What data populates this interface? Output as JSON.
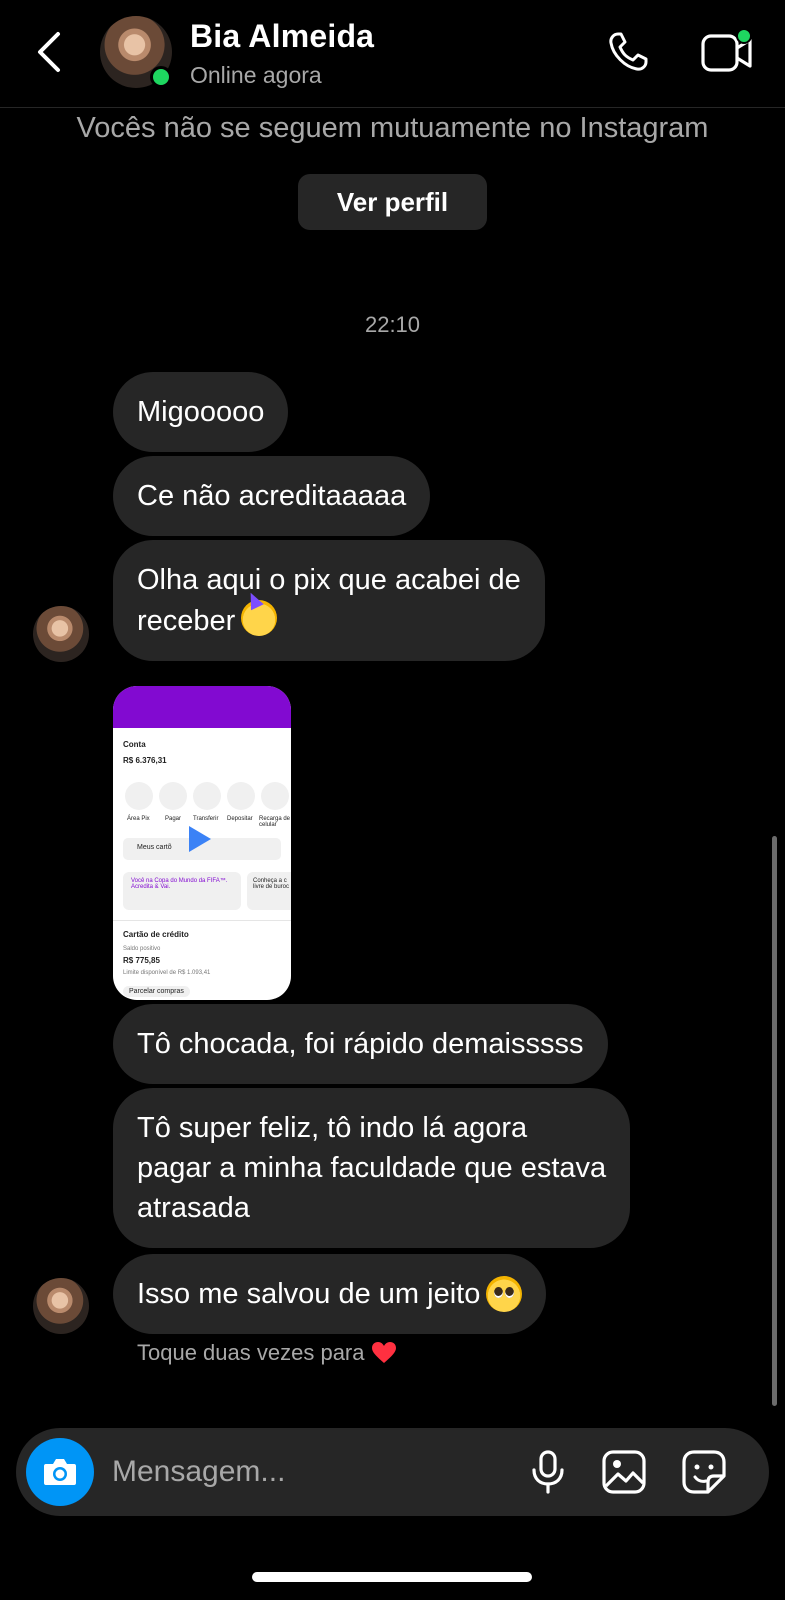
{
  "header": {
    "name": "Bia Almeida",
    "status": "Online agora",
    "back_icon": "chevron-left-icon",
    "call_icon": "phone-icon",
    "video_icon": "video-camera-icon"
  },
  "banner": {
    "mutual_text": "Vocês não se seguem mutuamente no Instagram",
    "view_profile": "Ver perfil"
  },
  "timestamp": "22:10",
  "messages": [
    {
      "text": "Migooooo"
    },
    {
      "text": "Ce não acreditaaaaa"
    },
    {
      "line1": "Olha aqui o pix que acabei de",
      "line2": "receber",
      "emoji": "partying-face"
    },
    {
      "text": "Tô chocada, foi rápido demaisssss"
    },
    {
      "line1": "Tô super feliz, tô indo lá agora",
      "line2": "pagar a minha faculdade que estava",
      "line3": "atrasada"
    },
    {
      "text": "Isso me salvou de um jeito",
      "emoji": "pleading-face"
    }
  ],
  "video": {
    "account": "Conta",
    "balance": "R$ 6.376,31",
    "actions": [
      "Área Pix",
      "Pagar",
      "Transferir",
      "Depositar",
      "Recarga de celular"
    ],
    "cards": "Meus cartõ",
    "promo1": "Você na Copa do Mundo da FIFA™. Acredita & Vai.",
    "promo2": "Conheça a c livre de buroc",
    "credit": "Cartão de crédito",
    "credit_status": "Saldo positivo",
    "credit_value": "R$ 775,85",
    "credit_limit": "Limite disponível de R$ 1.093,41",
    "installments": "Parcelar compras"
  },
  "hint": "Toque duas vezes para",
  "composer": {
    "placeholder": "Mensagem...",
    "camera_icon": "camera-icon",
    "mic_icon": "microphone-icon",
    "gallery_icon": "image-icon",
    "sticker_icon": "sticker-icon"
  },
  "colors": {
    "background": "#000000",
    "bubble": "#262626",
    "secondary_text": "#a8a8a8",
    "online": "#1ed760",
    "camera_button": "#0095f6",
    "nubank_purple": "#820ad1"
  }
}
